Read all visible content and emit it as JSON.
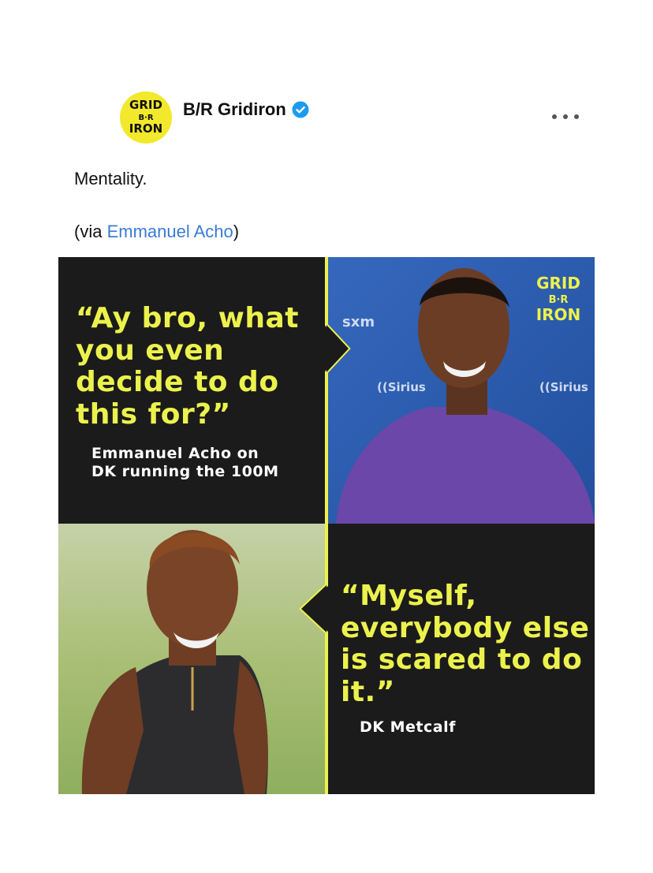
{
  "post": {
    "account_name": "B/R Gridiron",
    "avatar_lines": [
      "GRID",
      "B·R",
      "IRON"
    ],
    "caption": "Mentality.",
    "via_prefix": "(via ",
    "via_link": "Emmanuel Acho",
    "via_suffix": ")"
  },
  "graphic": {
    "quote_top": "“Ay bro, what you even decide to do this for?”",
    "attrib_top_line1": "Emmanuel Acho on",
    "attrib_top_line2": "DK running the 100M",
    "quote_bottom": "“Myself, everybody else is scared to do it.”",
    "attrib_bottom": "DK Metcalf",
    "watermark_lines": [
      "GRID",
      "B·R",
      "IRON"
    ],
    "backdrop_brand_1": "sxm",
    "backdrop_brand_2": "((Sirius"
  },
  "colors": {
    "accent_yellow": "#ecf24c",
    "avatar_yellow": "#f2e92c",
    "panel_dark": "#1b1b1b",
    "backdrop_blue": "#2b5fb0",
    "link_blue": "#3a7bd5",
    "verified_blue": "#1d9bf0"
  }
}
